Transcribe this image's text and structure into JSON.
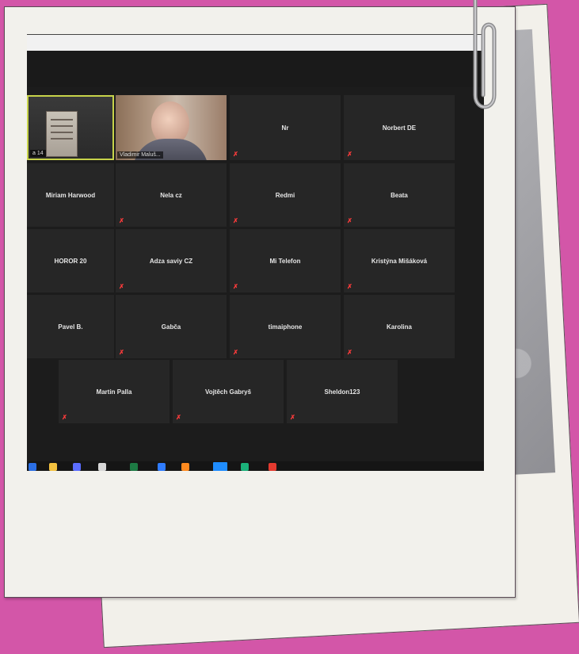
{
  "scene": {
    "background_color": "#d356a8"
  },
  "meeting": {
    "video_tiles": [
      {
        "label": "a 14"
      },
      {
        "label": "Vladimir Maluš..."
      }
    ],
    "participants": [
      {
        "name": "Nr"
      },
      {
        "name": "Norbert DE"
      },
      {
        "name": "Miriam Harwood"
      },
      {
        "name": "Nela cz"
      },
      {
        "name": "Redmi"
      },
      {
        "name": "Beata"
      },
      {
        "name": "HOROR 20"
      },
      {
        "name": "Adza saviy CZ"
      },
      {
        "name": "Mi Telefon"
      },
      {
        "name": "Kristýna Mišáková"
      },
      {
        "name": "Pavel B."
      },
      {
        "name": "Gabča"
      },
      {
        "name": "timaiphone"
      },
      {
        "name": "Karolina"
      },
      {
        "name": "Martin Palla"
      },
      {
        "name": "Vojtěch Gabryš"
      },
      {
        "name": "Sheldon123"
      }
    ],
    "mute_icon": "muted-mic-icon",
    "colors": {
      "tile_bg": "#262626",
      "active_speaker_border": "#c7d34a",
      "mute_red": "#ff3b3b"
    }
  },
  "taskbar": {
    "icons": [
      "windows-icon",
      "folder-icon",
      "calculator-icon",
      "store-icon",
      "excel-icon",
      "vscode-icon",
      "firefox-icon",
      "zoom-icon",
      "xbox-icon",
      "office-icon"
    ]
  },
  "decor": {
    "paperclip_icon": "paperclip-icon"
  }
}
